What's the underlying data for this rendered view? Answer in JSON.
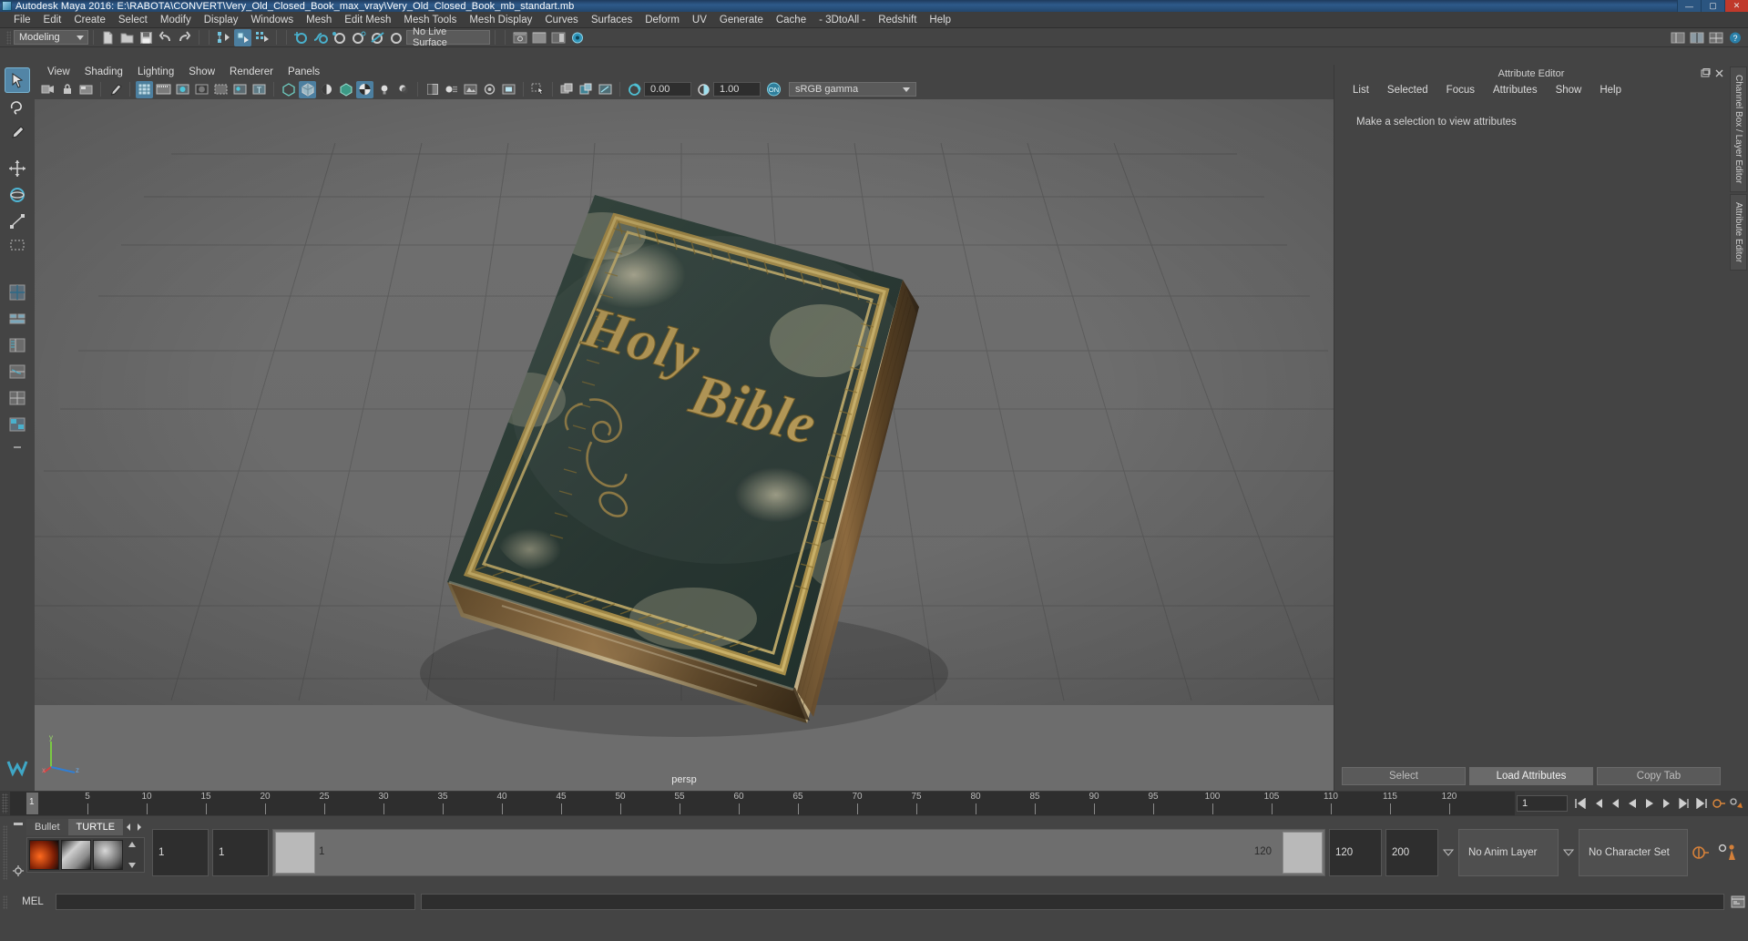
{
  "window": {
    "title": "Autodesk Maya 2016: E:\\RABOTA\\CONVERT\\Very_Old_Closed_Book_max_vray\\Very_Old_Closed_Book_mb_standart.mb",
    "minimize": "—",
    "maximize": "▢",
    "close": "✕"
  },
  "menubar": {
    "items": [
      "File",
      "Edit",
      "Create",
      "Select",
      "Modify",
      "Display",
      "Windows",
      "Mesh",
      "Edit Mesh",
      "Mesh Tools",
      "Mesh Display",
      "Curves",
      "Surfaces",
      "Deform",
      "UV",
      "Generate",
      "Cache",
      "- 3DtoAll -",
      "Redshift",
      "Help"
    ]
  },
  "statusline": {
    "menuset": "Modeling",
    "live_surface": "No Live Surface",
    "icons": [
      "new-scene-icon",
      "open-scene-icon",
      "save-scene-icon",
      "undo-icon",
      "redo-icon",
      "select-by-hierarchy-icon",
      "select-by-object-icon",
      "select-by-component-icon",
      "snap-to-grid-icon",
      "snap-to-curve-icon",
      "snap-to-point-icon",
      "snap-to-projected-center-icon",
      "snap-to-view-plane-icon",
      "make-live-icon",
      "show-hide-editors-icon"
    ]
  },
  "toolbox": {
    "items": [
      {
        "name": "select-tool",
        "selected": true
      },
      {
        "name": "lasso-select-tool",
        "selected": false
      },
      {
        "name": "paint-select-tool",
        "selected": false
      },
      {
        "name": "move-tool",
        "selected": false
      },
      {
        "name": "rotate-tool",
        "selected": false
      },
      {
        "name": "scale-tool",
        "selected": false
      },
      {
        "name": "last-tool-used",
        "selected": false
      },
      {
        "name": "single-perspective-layout",
        "selected": false
      },
      {
        "name": "four-view-layout",
        "selected": false
      },
      {
        "name": "persp-outliner-layout",
        "selected": false
      },
      {
        "name": "persp-graph-layout",
        "selected": false
      },
      {
        "name": "hypershade-persp-layout",
        "selected": false
      },
      {
        "name": "persp-uv-layout",
        "selected": false
      },
      {
        "name": "more-layouts",
        "selected": false
      }
    ]
  },
  "viewport": {
    "menus": [
      "View",
      "Shading",
      "Lighting",
      "Show",
      "Renderer",
      "Panels"
    ],
    "camera_label": "persp",
    "exposure": "0.00",
    "gamma": "1.00",
    "color_profile": "sRGB gamma",
    "view_gate_toggle": "ON",
    "toolbar_icons": [
      "select-camera-icon",
      "lock-camera-icon",
      "camera-attributes-icon",
      "bookmarks-icon",
      "image-plane-icon",
      "grid-toggle-icon",
      "film-gate-icon",
      "resolution-gate-icon",
      "gate-mask-icon",
      "xray-icon",
      "xray-joints-icon",
      "texture-toggle-icon",
      "wireframe-shading-icon",
      "smooth-shading-icon",
      "smooth-shade-all-icon",
      "shaded-wireframe-icon",
      "textured-mode-icon",
      "lights-icon",
      "shadows-icon",
      "screen-space-ao-icon",
      "motion-blur-icon",
      "multisample-icon",
      "depth-of-field-icon",
      "isolate-select-icon",
      "grid-display-icon",
      "film-gate-display-icon",
      "exposure-icon",
      "gamma-icon",
      "view-transform-icon"
    ]
  },
  "attribute_editor": {
    "title": "Attribute Editor",
    "menus": [
      "List",
      "Selected",
      "Focus",
      "Attributes",
      "Show",
      "Help"
    ],
    "empty_message": "Make a selection to view attributes",
    "buttons": [
      {
        "label": "Select",
        "active": false
      },
      {
        "label": "Load Attributes",
        "active": true
      },
      {
        "label": "Copy Tab",
        "active": false
      }
    ]
  },
  "right_tabs": [
    "Channel Box / Layer Editor",
    "Attribute Editor"
  ],
  "timeline": {
    "current_frame": "1",
    "current_frame_field": "1",
    "ticks": [
      5,
      10,
      15,
      20,
      25,
      30,
      35,
      40,
      45,
      50,
      55,
      60,
      65,
      70,
      75,
      80,
      85,
      90,
      95,
      100,
      105,
      110,
      115,
      120
    ],
    "playback_icons": [
      "go-to-start-icon",
      "step-back-keyframe-icon",
      "step-back-frame-icon",
      "play-backwards-icon",
      "play-forwards-icon",
      "step-forward-frame-icon",
      "step-forward-keyframe-icon",
      "go-to-end-icon",
      "auto-key-icon",
      "animation-preferences-icon"
    ]
  },
  "range_slider": {
    "shelf_tabs": [
      "Bullet",
      "TURTLE"
    ],
    "shelf_active_tab": "TURTLE",
    "shelf_icons": [
      "turtle-render-icon",
      "turtle-bake-icon",
      "turtle-texture-icon"
    ],
    "range_start": "1",
    "anim_start": "1",
    "slider_start_label": "1",
    "slider_end_label": "120",
    "anim_end": "120",
    "range_end": "200",
    "anim_layer": "No Anim Layer",
    "character_set": "No Character Set",
    "extra_icons": [
      "auto-key-toggle-icon",
      "animation-preferences-icon"
    ]
  },
  "command_line": {
    "label": "MEL",
    "input_value": "",
    "output_value": "",
    "script-editor-icon": "script-editor-icon"
  },
  "colors": {
    "accent": "#5285a6",
    "panel_bg": "#444444",
    "viewport_bg": "#6d6d6d",
    "dark_field": "#2e2e2e",
    "title_blue": "#2e5a8a"
  }
}
